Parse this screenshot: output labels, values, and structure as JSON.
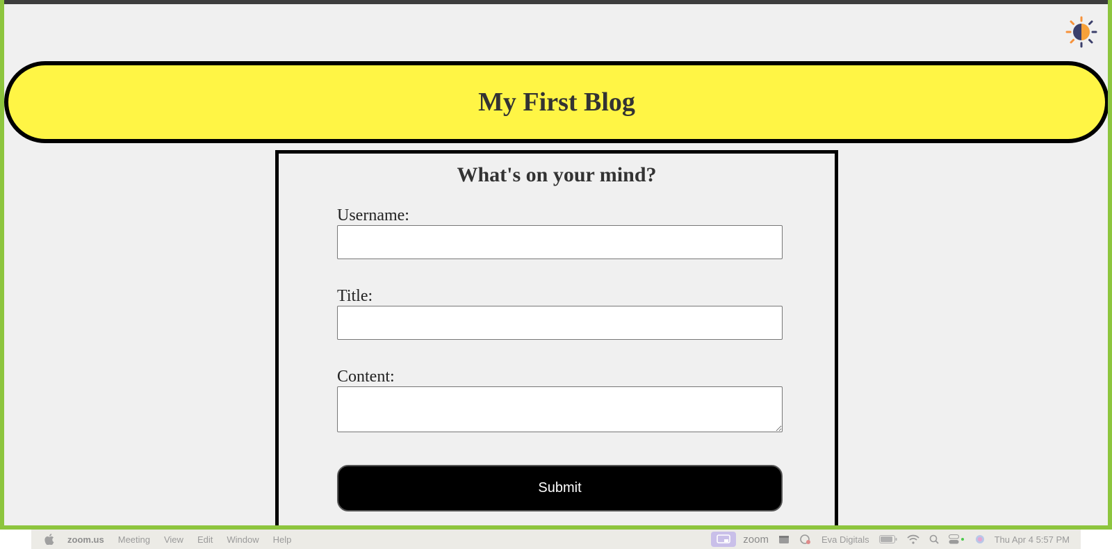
{
  "header": {
    "title": "My First Blog"
  },
  "form": {
    "heading": "What's on your mind?",
    "username_label": "Username:",
    "username_value": "",
    "title_label": "Title:",
    "title_value": "",
    "content_label": "Content:",
    "content_value": "",
    "submit_label": "Submit"
  },
  "theme_toggle": {
    "icon": "half-sun-icon"
  },
  "colors": {
    "header_bg": "#fff545",
    "page_bg": "#f0f0f0",
    "frame_border": "#8dc53e",
    "button_bg": "#000000"
  },
  "menubar": {
    "app_name": "zoom.us",
    "items": [
      "Meeting",
      "View",
      "Edit",
      "Window",
      "Help"
    ],
    "zoom_label": "zoom",
    "user_label": "Eva Digitals",
    "datetime": "Thu Apr 4  5:57 PM"
  }
}
